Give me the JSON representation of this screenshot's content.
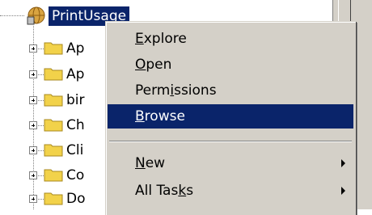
{
  "tree": {
    "root_label": "PrintUsage",
    "children": [
      {
        "label": "Ap"
      },
      {
        "label": "Ap"
      },
      {
        "label": "bir"
      },
      {
        "label": "Ch"
      },
      {
        "label": "Cli"
      },
      {
        "label": "Co"
      },
      {
        "label": "Do"
      }
    ]
  },
  "context_menu": {
    "items": [
      {
        "pre": "",
        "key": "E",
        "post": "xplore"
      },
      {
        "pre": "",
        "key": "O",
        "post": "pen"
      },
      {
        "pre": "Perm",
        "key": "i",
        "post": "ssions"
      },
      {
        "pre": "",
        "key": "B",
        "post": "rowse"
      },
      {
        "pre": "",
        "key": "N",
        "post": "ew"
      },
      {
        "pre": "All Tas",
        "key": "k",
        "post": "s"
      }
    ]
  },
  "colors": {
    "selection": "#0a246a",
    "menu_background": "#d4d0c8",
    "folder_yellow": "#f2d24a"
  },
  "icons": {
    "root": "server-globe-icon",
    "child": "folder-icon",
    "expander": "plus-box-icon",
    "submenu": "submenu-arrow-icon"
  }
}
